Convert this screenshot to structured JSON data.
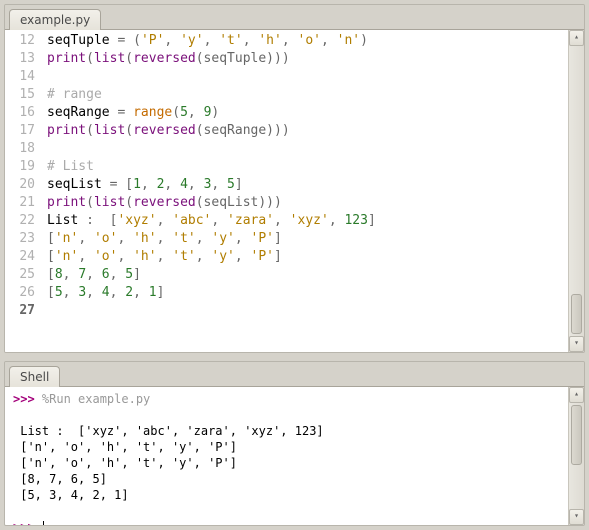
{
  "editor": {
    "filename": "example.py",
    "first_line": 12,
    "current_line": 27,
    "lines": [
      [
        {
          "t": "seqTuple ",
          "c": ""
        },
        {
          "t": "= (",
          "c": "op"
        },
        {
          "t": "'P'",
          "c": "str"
        },
        {
          "t": ", ",
          "c": "op"
        },
        {
          "t": "'y'",
          "c": "str"
        },
        {
          "t": ", ",
          "c": "op"
        },
        {
          "t": "'t'",
          "c": "str"
        },
        {
          "t": ", ",
          "c": "op"
        },
        {
          "t": "'h'",
          "c": "str"
        },
        {
          "t": ", ",
          "c": "op"
        },
        {
          "t": "'o'",
          "c": "str"
        },
        {
          "t": ", ",
          "c": "op"
        },
        {
          "t": "'n'",
          "c": "str"
        },
        {
          "t": ")",
          "c": "op"
        }
      ],
      [
        {
          "t": "print",
          "c": "fn"
        },
        {
          "t": "(",
          "c": "op"
        },
        {
          "t": "list",
          "c": "fn"
        },
        {
          "t": "(",
          "c": "op"
        },
        {
          "t": "reversed",
          "c": "fn"
        },
        {
          "t": "(seqTuple)))",
          "c": "op"
        }
      ],
      [],
      [
        {
          "t": "# range",
          "c": "cm"
        }
      ],
      [
        {
          "t": "seqRange ",
          "c": ""
        },
        {
          "t": "= ",
          "c": "op"
        },
        {
          "t": "range",
          "c": "kw"
        },
        {
          "t": "(",
          "c": "op"
        },
        {
          "t": "5",
          "c": "num"
        },
        {
          "t": ", ",
          "c": "op"
        },
        {
          "t": "9",
          "c": "num"
        },
        {
          "t": ")",
          "c": "op"
        }
      ],
      [
        {
          "t": "print",
          "c": "fn"
        },
        {
          "t": "(",
          "c": "op"
        },
        {
          "t": "list",
          "c": "fn"
        },
        {
          "t": "(",
          "c": "op"
        },
        {
          "t": "reversed",
          "c": "fn"
        },
        {
          "t": "(seqRange)))",
          "c": "op"
        }
      ],
      [],
      [
        {
          "t": "# List",
          "c": "cm"
        }
      ],
      [
        {
          "t": "seqList ",
          "c": ""
        },
        {
          "t": "= [",
          "c": "op"
        },
        {
          "t": "1",
          "c": "num"
        },
        {
          "t": ", ",
          "c": "op"
        },
        {
          "t": "2",
          "c": "num"
        },
        {
          "t": ", ",
          "c": "op"
        },
        {
          "t": "4",
          "c": "num"
        },
        {
          "t": ", ",
          "c": "op"
        },
        {
          "t": "3",
          "c": "num"
        },
        {
          "t": ", ",
          "c": "op"
        },
        {
          "t": "5",
          "c": "num"
        },
        {
          "t": "]",
          "c": "op"
        }
      ],
      [
        {
          "t": "print",
          "c": "fn"
        },
        {
          "t": "(",
          "c": "op"
        },
        {
          "t": "list",
          "c": "fn"
        },
        {
          "t": "(",
          "c": "op"
        },
        {
          "t": "reversed",
          "c": "fn"
        },
        {
          "t": "(seqList)))",
          "c": "op"
        }
      ],
      [
        {
          "t": "List ",
          "c": ""
        },
        {
          "t": ":  [",
          "c": "op"
        },
        {
          "t": "'xyz'",
          "c": "str"
        },
        {
          "t": ", ",
          "c": "op"
        },
        {
          "t": "'abc'",
          "c": "str"
        },
        {
          "t": ", ",
          "c": "op"
        },
        {
          "t": "'zara'",
          "c": "str"
        },
        {
          "t": ", ",
          "c": "op"
        },
        {
          "t": "'xyz'",
          "c": "str"
        },
        {
          "t": ", ",
          "c": "op"
        },
        {
          "t": "123",
          "c": "num"
        },
        {
          "t": "]",
          "c": "op"
        }
      ],
      [
        {
          "t": "[",
          "c": "op"
        },
        {
          "t": "'n'",
          "c": "str"
        },
        {
          "t": ", ",
          "c": "op"
        },
        {
          "t": "'o'",
          "c": "str"
        },
        {
          "t": ", ",
          "c": "op"
        },
        {
          "t": "'h'",
          "c": "str"
        },
        {
          "t": ", ",
          "c": "op"
        },
        {
          "t": "'t'",
          "c": "str"
        },
        {
          "t": ", ",
          "c": "op"
        },
        {
          "t": "'y'",
          "c": "str"
        },
        {
          "t": ", ",
          "c": "op"
        },
        {
          "t": "'P'",
          "c": "str"
        },
        {
          "t": "]",
          "c": "op"
        }
      ],
      [
        {
          "t": "[",
          "c": "op"
        },
        {
          "t": "'n'",
          "c": "str"
        },
        {
          "t": ", ",
          "c": "op"
        },
        {
          "t": "'o'",
          "c": "str"
        },
        {
          "t": ", ",
          "c": "op"
        },
        {
          "t": "'h'",
          "c": "str"
        },
        {
          "t": ", ",
          "c": "op"
        },
        {
          "t": "'t'",
          "c": "str"
        },
        {
          "t": ", ",
          "c": "op"
        },
        {
          "t": "'y'",
          "c": "str"
        },
        {
          "t": ", ",
          "c": "op"
        },
        {
          "t": "'P'",
          "c": "str"
        },
        {
          "t": "]",
          "c": "op"
        }
      ],
      [
        {
          "t": "[",
          "c": "op"
        },
        {
          "t": "8",
          "c": "num"
        },
        {
          "t": ", ",
          "c": "op"
        },
        {
          "t": "7",
          "c": "num"
        },
        {
          "t": ", ",
          "c": "op"
        },
        {
          "t": "6",
          "c": "num"
        },
        {
          "t": ", ",
          "c": "op"
        },
        {
          "t": "5",
          "c": "num"
        },
        {
          "t": "]",
          "c": "op"
        }
      ],
      [
        {
          "t": "[",
          "c": "op"
        },
        {
          "t": "5",
          "c": "num"
        },
        {
          "t": ", ",
          "c": "op"
        },
        {
          "t": "3",
          "c": "num"
        },
        {
          "t": ", ",
          "c": "op"
        },
        {
          "t": "4",
          "c": "num"
        },
        {
          "t": ", ",
          "c": "op"
        },
        {
          "t": "2",
          "c": "num"
        },
        {
          "t": ", ",
          "c": "op"
        },
        {
          "t": "1",
          "c": "num"
        },
        {
          "t": "]",
          "c": "op"
        }
      ],
      []
    ]
  },
  "shell": {
    "title": "Shell",
    "prompt": ">>> ",
    "run_cmd": "%Run example.py",
    "output": [
      " List :  ['xyz', 'abc', 'zara', 'xyz', 123]",
      " ['n', 'o', 'h', 't', 'y', 'P']",
      " ['n', 'o', 'h', 't', 'y', 'P']",
      " [8, 7, 6, 5]",
      " [5, 3, 4, 2, 1]"
    ]
  }
}
